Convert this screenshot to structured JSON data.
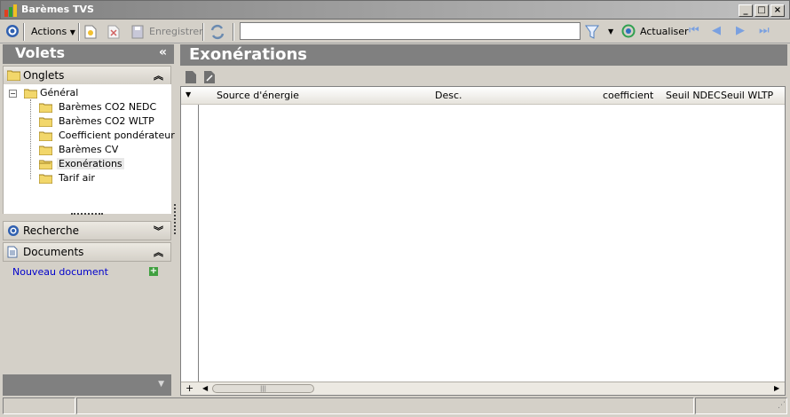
{
  "window": {
    "title": "Barèmes TVS"
  },
  "toolbar": {
    "actions_label": "Actions",
    "save_label": "Enregistrer",
    "search_value": "",
    "refresh_label": "Actualiser"
  },
  "left_pane": {
    "title": "Volets",
    "sections": {
      "tabs": {
        "label": "Onglets"
      },
      "search": {
        "label": "Recherche"
      },
      "documents": {
        "label": "Documents"
      }
    },
    "tree": {
      "root": "Général",
      "children": [
        "Barèmes CO2 NEDC",
        "Barèmes CO2 WLTP",
        "Coefficient pondérateur",
        "Barèmes CV",
        "Exonérations",
        "Tarif air"
      ],
      "selected_index": 4
    },
    "new_document_label": "Nouveau document"
  },
  "main": {
    "title": "Exonérations",
    "columns": [
      "Source d'énergie",
      "Desc.",
      "coefficient",
      "Seuil NDEC",
      "Seuil WLTP"
    ]
  },
  "colors": {
    "header_gray": "#808080",
    "link_blue": "#0000cc",
    "folder_yellow": "#f2d76b",
    "selection": "#e8e8e8"
  }
}
